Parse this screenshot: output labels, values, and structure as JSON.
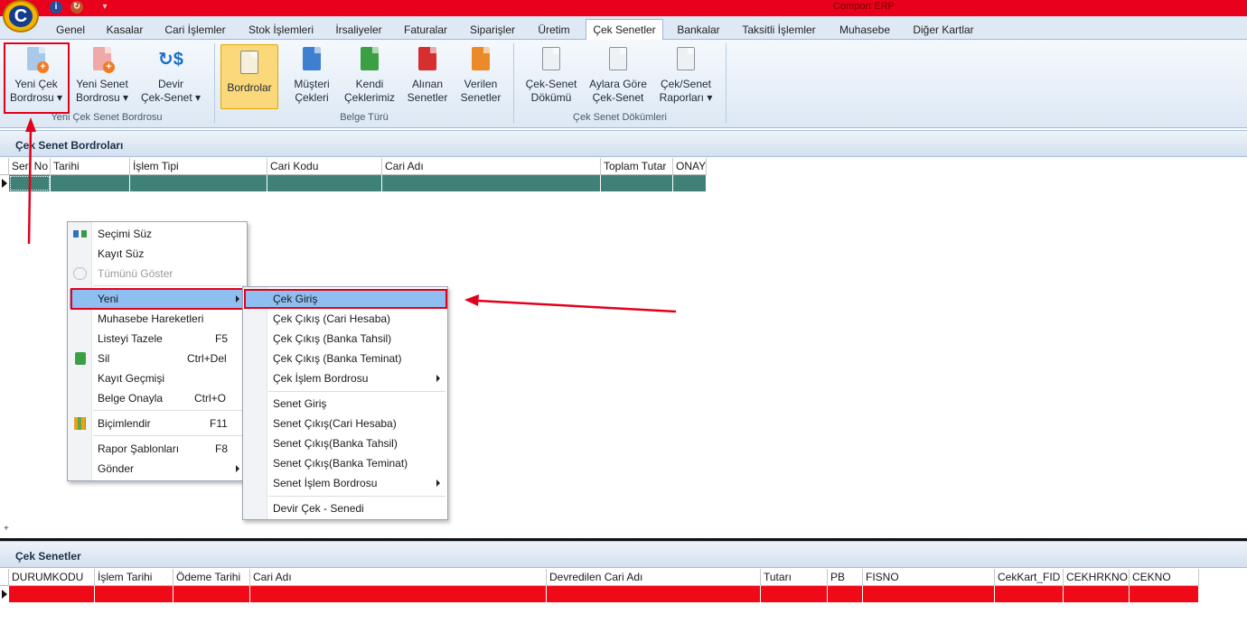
{
  "app": {
    "title": "Comport ERP",
    "logo_letter": "C",
    "icons": [
      "info-icon",
      "refresh-icon",
      "pin-icon"
    ]
  },
  "colors": {
    "titlebar": "#e8001c",
    "ribbon_active": "#fbd97a",
    "row_selected": "#3f8077",
    "row_error": "#f00a17",
    "annotation": "#e3001b",
    "menu_highlight": "#8fbef0"
  },
  "tabs": [
    "Genel",
    "Kasalar",
    "Cari İşlemler",
    "Stok İşlemleri",
    "İrsaliyeler",
    "Faturalar",
    "Siparişler",
    "Üretim",
    "Çek Senetler",
    "Bankalar",
    "Taksitli İşlemler",
    "Muhasebe",
    "Diğer Kartlar"
  ],
  "active_tab": "Çek Senetler",
  "ribbon": {
    "groups": [
      {
        "label": "Yeni Çek Senet Bordrosu",
        "buttons": [
          {
            "line1": "Yeni Çek",
            "line2": "Bordrosu ▾",
            "icon": "new-check-icon"
          },
          {
            "line1": "Yeni Senet",
            "line2": "Bordrosu ▾",
            "icon": "new-note-icon"
          },
          {
            "line1": "Devir",
            "line2": "Çek-Senet ▾",
            "icon": "transfer-icon"
          }
        ]
      },
      {
        "label": "Belge Türü",
        "buttons": [
          {
            "line1": "Bordrolar",
            "line2": "",
            "icon": "folder-icon"
          },
          {
            "line1": "Müşteri",
            "line2": "Çekleri",
            "icon": "customer-checks-icon"
          },
          {
            "line1": "Kendi",
            "line2": "Çeklerimiz",
            "icon": "own-checks-icon"
          },
          {
            "line1": "Alınan",
            "line2": "Senetler",
            "icon": "received-notes-icon"
          },
          {
            "line1": "Verilen",
            "line2": "Senetler",
            "icon": "given-notes-icon"
          }
        ]
      },
      {
        "label": "Çek Senet Dökümleri",
        "buttons": [
          {
            "line1": "Çek-Senet",
            "line2": "Dökümü",
            "icon": "report-icon"
          },
          {
            "line1": "Aylara Göre",
            "line2": "Çek-Senet",
            "icon": "monthly-report-icon"
          },
          {
            "line1": "Çek/Senet",
            "line2": "Raporları ▾",
            "icon": "reports-icon"
          }
        ]
      }
    ]
  },
  "panel_top": {
    "title": "Çek Senet Bordroları",
    "columns": [
      "Seri No",
      "Tarihi",
      "İşlem Tipi",
      "Cari Kodu",
      "Cari Adı",
      "Toplam Tutar",
      "ONAY"
    ]
  },
  "panel_bottom": {
    "title": "Çek Senetler",
    "columns": [
      "DURUMKODU",
      "İşlem Tarihi",
      "Ödeme Tarihi",
      "Cari Adı",
      "Devredilen Cari Adı",
      "Tutarı",
      "PB",
      "FISNO",
      "CekKart_FID",
      "CEKHRKNO",
      "CEKNO"
    ]
  },
  "context_menu": [
    {
      "label": "Seçimi Süz",
      "shortcut": "",
      "icon": "filter-selection-icon"
    },
    {
      "label": "Kayıt Süz",
      "shortcut": ""
    },
    {
      "label": "Tümünü Göster",
      "shortcut": "",
      "icon": "show-all-icon",
      "disabled": true
    },
    {
      "label": "Yeni",
      "shortcut": "",
      "submenu": true
    },
    {
      "label": "Muhasebe Hareketleri",
      "shortcut": ""
    },
    {
      "label": "Listeyi Tazele",
      "shortcut": "F5"
    },
    {
      "label": "Sil",
      "shortcut": "Ctrl+Del",
      "icon": "delete-icon"
    },
    {
      "label": "Kayıt Geçmişi",
      "shortcut": ""
    },
    {
      "label": "Belge Onayla",
      "shortcut": "Ctrl+O"
    },
    {
      "label": "Biçimlendir",
      "shortcut": "F11",
      "icon": "format-grid-icon"
    },
    {
      "label": "Rapor Şablonları",
      "shortcut": "F8"
    },
    {
      "label": "Gönder",
      "shortcut": "",
      "submenu": true
    }
  ],
  "submenu": [
    {
      "label": "Çek Giriş"
    },
    {
      "label": "Çek Çıkış (Cari Hesaba)"
    },
    {
      "label": "Çek Çıkış (Banka Tahsil)"
    },
    {
      "label": "Çek Çıkış (Banka Teminat)"
    },
    {
      "label": "Çek İşlem Bordrosu",
      "submenu": true
    },
    {
      "label": "Senet Giriş"
    },
    {
      "label": "Senet Çıkış(Cari Hesaba)"
    },
    {
      "label": "Senet Çıkış(Banka Tahsil)"
    },
    {
      "label": "Senet Çıkış(Banka Teminat)"
    },
    {
      "label": "Senet İşlem Bordrosu",
      "submenu": true
    },
    {
      "label": "Devir Çek - Senedi"
    }
  ]
}
